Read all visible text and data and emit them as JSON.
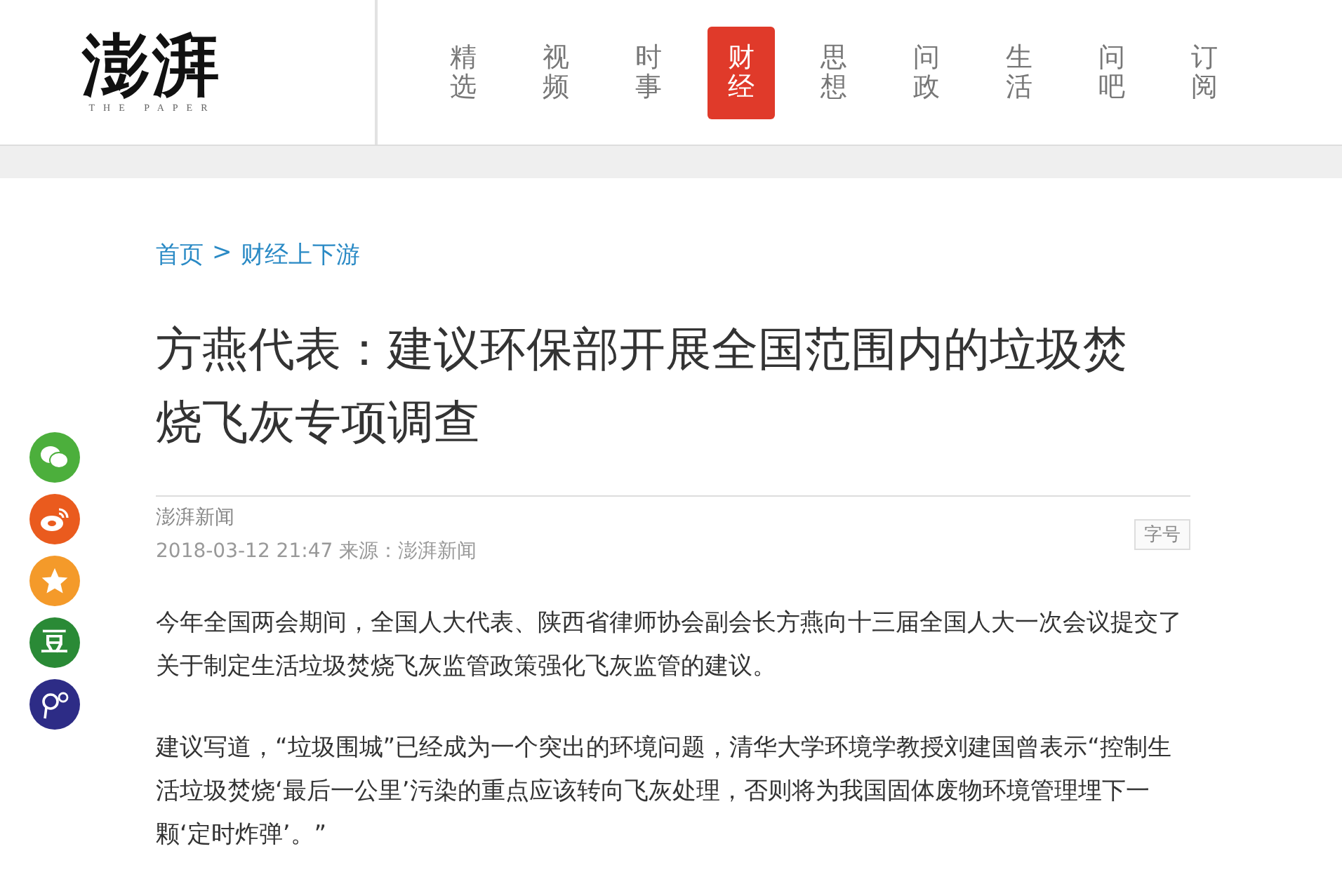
{
  "logo": {
    "title": "澎湃",
    "subtitle": "THE PAPER"
  },
  "nav": [
    {
      "label": "精选",
      "selected": false
    },
    {
      "label": "视频",
      "selected": false
    },
    {
      "label": "时事",
      "selected": false
    },
    {
      "label": "财经",
      "selected": true
    },
    {
      "label": "思想",
      "selected": false
    },
    {
      "label": "问政",
      "selected": false
    },
    {
      "label": "生活",
      "selected": false
    },
    {
      "label": "问吧",
      "selected": false
    },
    {
      "label": "订阅",
      "selected": false
    }
  ],
  "share": [
    {
      "kind": "wechat"
    },
    {
      "kind": "weibo"
    },
    {
      "kind": "qzone"
    },
    {
      "kind": "douban",
      "label": "豆"
    },
    {
      "kind": "other"
    }
  ],
  "breadcrumb": [
    "首页",
    "财经上下游"
  ],
  "breadcrumb_separator": ">",
  "title": "方燕代表：建议环保部开展全国范围内的垃圾焚烧飞灰专项调查",
  "author": "澎湃新闻",
  "meta": "2018-03-12 21:47 来源：澎湃新闻",
  "font_button": "字号",
  "paragraphs": [
    "今年全国两会期间，全国人大代表、陕西省律师协会副会长方燕向十三届全国人大一次会议提交了关于制定生活垃圾焚烧飞灰监管政策强化飞灰监管的建议。",
    "建议写道，“垃圾围城”已经成为一个突出的环境问题，清华大学环境学教授刘建国曾表示“控制生活垃圾焚烧‘最后一公里’污染的重点应该转向飞灰处理，否则将为我国固体废物环境管理埋下一颗‘定时炸弹’。”"
  ]
}
